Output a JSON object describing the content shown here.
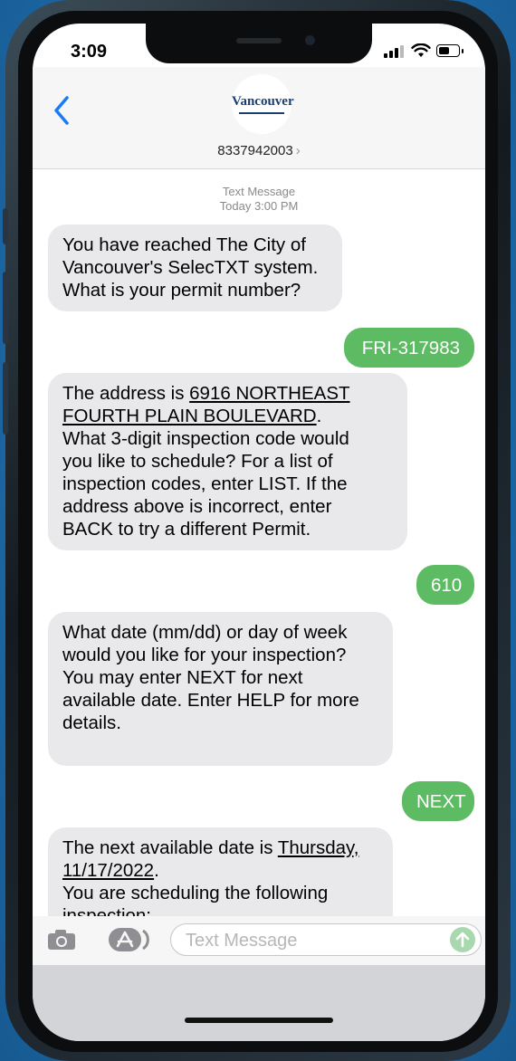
{
  "status": {
    "time": "3:09"
  },
  "header": {
    "contact_number": "8337942003",
    "logo_text": "Vancouver"
  },
  "thread": {
    "timestamp_line1": "Text Message",
    "timestamp_line2": "Today 3:00 PM",
    "messages": [
      {
        "line1": "You have reached The City of",
        "line2": "Vancouver's SelecTXT system.",
        "line3": "What is your permit number?"
      },
      {
        "text": "FRI-317983"
      },
      {
        "pre": "The address is ",
        "addr1": "6916 NORTHEAST",
        "addr2": "FOURTH PLAIN BOULEVARD",
        "addr_end": ".",
        "line3": "What 3-digit inspection code would",
        "line4": "you like to schedule? For a list of",
        "line5": "inspection codes, enter LIST. If the",
        "line6": "address above is incorrect, enter",
        "line7": "BACK to try a different Permit."
      },
      {
        "text": "610"
      },
      {
        "line1": "What date (mm/dd) or day of week",
        "line2": "would you like for your inspection?",
        "line3": "You may enter NEXT for next",
        "line4": "available date. Enter HELP for more",
        "line5": "details."
      },
      {
        "text": "NEXT"
      },
      {
        "pre": "The next available date is ",
        "day": "Thursday,",
        "date": "11/17/2022",
        "date_end": ".",
        "line3": "You are scheduling the following",
        "line4": "inspection:"
      }
    ]
  },
  "input": {
    "placeholder": "Text Message"
  },
  "colors": {
    "incoming_bubble": "#e9e9eb",
    "outgoing_bubble": "#5dbb63",
    "background": "#1f72b3"
  }
}
